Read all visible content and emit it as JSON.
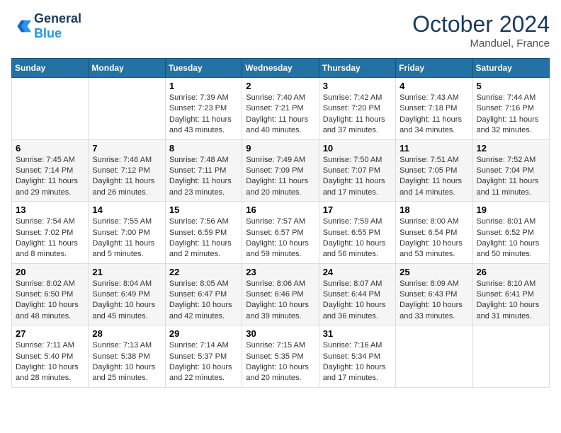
{
  "header": {
    "logo_text_general": "General",
    "logo_text_blue": "Blue",
    "month_title": "October 2024",
    "location": "Manduel, France"
  },
  "days_of_week": [
    "Sunday",
    "Monday",
    "Tuesday",
    "Wednesday",
    "Thursday",
    "Friday",
    "Saturday"
  ],
  "weeks": [
    [
      {
        "day": "",
        "info": ""
      },
      {
        "day": "",
        "info": ""
      },
      {
        "day": "1",
        "info": "Sunrise: 7:39 AM\nSunset: 7:23 PM\nDaylight: 11 hours and 43 minutes."
      },
      {
        "day": "2",
        "info": "Sunrise: 7:40 AM\nSunset: 7:21 PM\nDaylight: 11 hours and 40 minutes."
      },
      {
        "day": "3",
        "info": "Sunrise: 7:42 AM\nSunset: 7:20 PM\nDaylight: 11 hours and 37 minutes."
      },
      {
        "day": "4",
        "info": "Sunrise: 7:43 AM\nSunset: 7:18 PM\nDaylight: 11 hours and 34 minutes."
      },
      {
        "day": "5",
        "info": "Sunrise: 7:44 AM\nSunset: 7:16 PM\nDaylight: 11 hours and 32 minutes."
      }
    ],
    [
      {
        "day": "6",
        "info": "Sunrise: 7:45 AM\nSunset: 7:14 PM\nDaylight: 11 hours and 29 minutes."
      },
      {
        "day": "7",
        "info": "Sunrise: 7:46 AM\nSunset: 7:12 PM\nDaylight: 11 hours and 26 minutes."
      },
      {
        "day": "8",
        "info": "Sunrise: 7:48 AM\nSunset: 7:11 PM\nDaylight: 11 hours and 23 minutes."
      },
      {
        "day": "9",
        "info": "Sunrise: 7:49 AM\nSunset: 7:09 PM\nDaylight: 11 hours and 20 minutes."
      },
      {
        "day": "10",
        "info": "Sunrise: 7:50 AM\nSunset: 7:07 PM\nDaylight: 11 hours and 17 minutes."
      },
      {
        "day": "11",
        "info": "Sunrise: 7:51 AM\nSunset: 7:05 PM\nDaylight: 11 hours and 14 minutes."
      },
      {
        "day": "12",
        "info": "Sunrise: 7:52 AM\nSunset: 7:04 PM\nDaylight: 11 hours and 11 minutes."
      }
    ],
    [
      {
        "day": "13",
        "info": "Sunrise: 7:54 AM\nSunset: 7:02 PM\nDaylight: 11 hours and 8 minutes."
      },
      {
        "day": "14",
        "info": "Sunrise: 7:55 AM\nSunset: 7:00 PM\nDaylight: 11 hours and 5 minutes."
      },
      {
        "day": "15",
        "info": "Sunrise: 7:56 AM\nSunset: 6:59 PM\nDaylight: 11 hours and 2 minutes."
      },
      {
        "day": "16",
        "info": "Sunrise: 7:57 AM\nSunset: 6:57 PM\nDaylight: 10 hours and 59 minutes."
      },
      {
        "day": "17",
        "info": "Sunrise: 7:59 AM\nSunset: 6:55 PM\nDaylight: 10 hours and 56 minutes."
      },
      {
        "day": "18",
        "info": "Sunrise: 8:00 AM\nSunset: 6:54 PM\nDaylight: 10 hours and 53 minutes."
      },
      {
        "day": "19",
        "info": "Sunrise: 8:01 AM\nSunset: 6:52 PM\nDaylight: 10 hours and 50 minutes."
      }
    ],
    [
      {
        "day": "20",
        "info": "Sunrise: 8:02 AM\nSunset: 6:50 PM\nDaylight: 10 hours and 48 minutes."
      },
      {
        "day": "21",
        "info": "Sunrise: 8:04 AM\nSunset: 6:49 PM\nDaylight: 10 hours and 45 minutes."
      },
      {
        "day": "22",
        "info": "Sunrise: 8:05 AM\nSunset: 6:47 PM\nDaylight: 10 hours and 42 minutes."
      },
      {
        "day": "23",
        "info": "Sunrise: 8:06 AM\nSunset: 6:46 PM\nDaylight: 10 hours and 39 minutes."
      },
      {
        "day": "24",
        "info": "Sunrise: 8:07 AM\nSunset: 6:44 PM\nDaylight: 10 hours and 36 minutes."
      },
      {
        "day": "25",
        "info": "Sunrise: 8:09 AM\nSunset: 6:43 PM\nDaylight: 10 hours and 33 minutes."
      },
      {
        "day": "26",
        "info": "Sunrise: 8:10 AM\nSunset: 6:41 PM\nDaylight: 10 hours and 31 minutes."
      }
    ],
    [
      {
        "day": "27",
        "info": "Sunrise: 7:11 AM\nSunset: 5:40 PM\nDaylight: 10 hours and 28 minutes."
      },
      {
        "day": "28",
        "info": "Sunrise: 7:13 AM\nSunset: 5:38 PM\nDaylight: 10 hours and 25 minutes."
      },
      {
        "day": "29",
        "info": "Sunrise: 7:14 AM\nSunset: 5:37 PM\nDaylight: 10 hours and 22 minutes."
      },
      {
        "day": "30",
        "info": "Sunrise: 7:15 AM\nSunset: 5:35 PM\nDaylight: 10 hours and 20 minutes."
      },
      {
        "day": "31",
        "info": "Sunrise: 7:16 AM\nSunset: 5:34 PM\nDaylight: 10 hours and 17 minutes."
      },
      {
        "day": "",
        "info": ""
      },
      {
        "day": "",
        "info": ""
      }
    ]
  ]
}
